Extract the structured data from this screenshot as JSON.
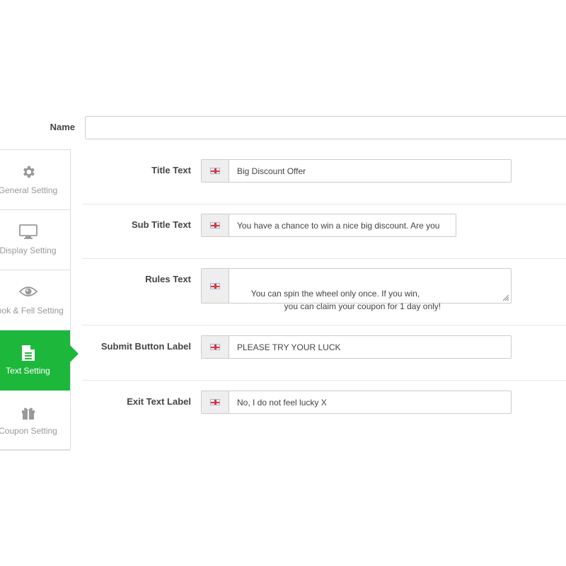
{
  "name_field": {
    "label": "Name",
    "value": ""
  },
  "tabs": [
    {
      "label": "General Setting",
      "icon": "gear-icon",
      "active": false
    },
    {
      "label": "Display Setting",
      "icon": "monitor-icon",
      "active": false
    },
    {
      "label": "Look & Fell Setting",
      "icon": "eye-icon",
      "active": false
    },
    {
      "label": "Text Setting",
      "icon": "document-icon",
      "active": true
    },
    {
      "label": "Coupon Setting",
      "icon": "gift-icon",
      "active": false
    }
  ],
  "fields": {
    "title_text": {
      "label": "Title Text",
      "value": "Big Discount Offer",
      "flag": "uk-flag-icon"
    },
    "sub_title_text": {
      "label": "Sub Title Text",
      "value": "You have a chance to win a nice big discount. Are you",
      "flag": "uk-flag-icon"
    },
    "rules_text": {
      "label": "Rules Text",
      "value": "You can spin the wheel only once. If you win,\n                    you can claim your coupon for 1 day only!",
      "flag": "uk-flag-icon"
    },
    "submit_button_label": {
      "label": "Submit Button Label",
      "value": "PLEASE TRY YOUR LUCK",
      "flag": "uk-flag-icon"
    },
    "exit_text_label": {
      "label": "Exit Text Label",
      "value": "No, I do not feel lucky X",
      "flag": "uk-flag-icon"
    }
  },
  "colors": {
    "accent": "#1db83b",
    "border": "#cccccc",
    "addon_bg": "#eeeeee",
    "muted_text": "#999999"
  }
}
